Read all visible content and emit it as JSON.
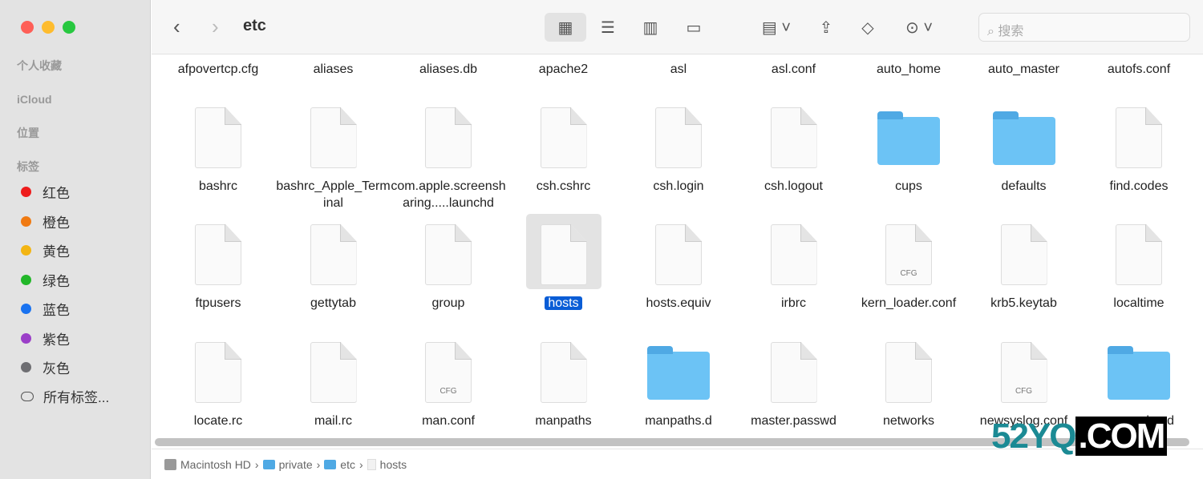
{
  "window": {
    "title": "etc"
  },
  "sidebar": {
    "sections": [
      "个人收藏",
      "iCloud",
      "位置",
      "标签"
    ],
    "tags": [
      {
        "label": "红色",
        "color": "#ee1c1c"
      },
      {
        "label": "橙色",
        "color": "#f07a12"
      },
      {
        "label": "黄色",
        "color": "#f3b513"
      },
      {
        "label": "绿色",
        "color": "#22b729"
      },
      {
        "label": "蓝色",
        "color": "#1a73f0"
      },
      {
        "label": "紫色",
        "color": "#9b3fc8"
      },
      {
        "label": "灰色",
        "color": "#6e6e72"
      }
    ],
    "all_tags": "所有标签..."
  },
  "toolbar": {
    "back": "‹",
    "forward": "›",
    "search_placeholder": "搜索",
    "view_icons": [
      "icon-view",
      "list-view",
      "column-view",
      "gallery-view"
    ],
    "actions": [
      "group-icon",
      "share-icon",
      "tag-icon",
      "more-icon"
    ]
  },
  "files": [
    [
      "afpovertcp.cfg",
      "aliases",
      "aliases.db",
      "apache2",
      "asl",
      "asl.conf",
      "auto_home",
      "auto_master",
      "autofs.conf"
    ],
    [
      {
        "name": "bashrc",
        "type": "file"
      },
      {
        "name": "bashrc_Apple_Terminal",
        "type": "file"
      },
      {
        "name": "com.apple.screensharing.....launchd",
        "type": "file"
      },
      {
        "name": "csh.cshrc",
        "type": "file"
      },
      {
        "name": "csh.login",
        "type": "file"
      },
      {
        "name": "csh.logout",
        "type": "file"
      },
      {
        "name": "cups",
        "type": "folder"
      },
      {
        "name": "defaults",
        "type": "folder"
      },
      {
        "name": "find.codes",
        "type": "file"
      }
    ],
    [
      {
        "name": "ftpusers",
        "type": "file"
      },
      {
        "name": "gettytab",
        "type": "file"
      },
      {
        "name": "group",
        "type": "file"
      },
      {
        "name": "hosts",
        "type": "file",
        "selected": true
      },
      {
        "name": "hosts.equiv",
        "type": "file"
      },
      {
        "name": "irbrc",
        "type": "file"
      },
      {
        "name": "kern_loader.conf",
        "type": "cfg",
        "badge": "CFG"
      },
      {
        "name": "krb5.keytab",
        "type": "file"
      },
      {
        "name": "localtime",
        "type": "alias"
      }
    ],
    [
      {
        "name": "locate.rc",
        "type": "file"
      },
      {
        "name": "mail.rc",
        "type": "file"
      },
      {
        "name": "man.conf",
        "type": "cfg",
        "badge": "CFG"
      },
      {
        "name": "manpaths",
        "type": "file"
      },
      {
        "name": "manpaths.d",
        "type": "folder"
      },
      {
        "name": "master.passwd",
        "type": "file"
      },
      {
        "name": "networks",
        "type": "file"
      },
      {
        "name": "newsyslog.conf",
        "type": "cfg",
        "badge": "CFG"
      },
      {
        "name": "newsyslog.d",
        "type": "folder"
      }
    ]
  ],
  "pathbar": [
    "Macintosh HD",
    "private",
    "etc",
    "hosts"
  ],
  "watermark": "52YQ.COM"
}
